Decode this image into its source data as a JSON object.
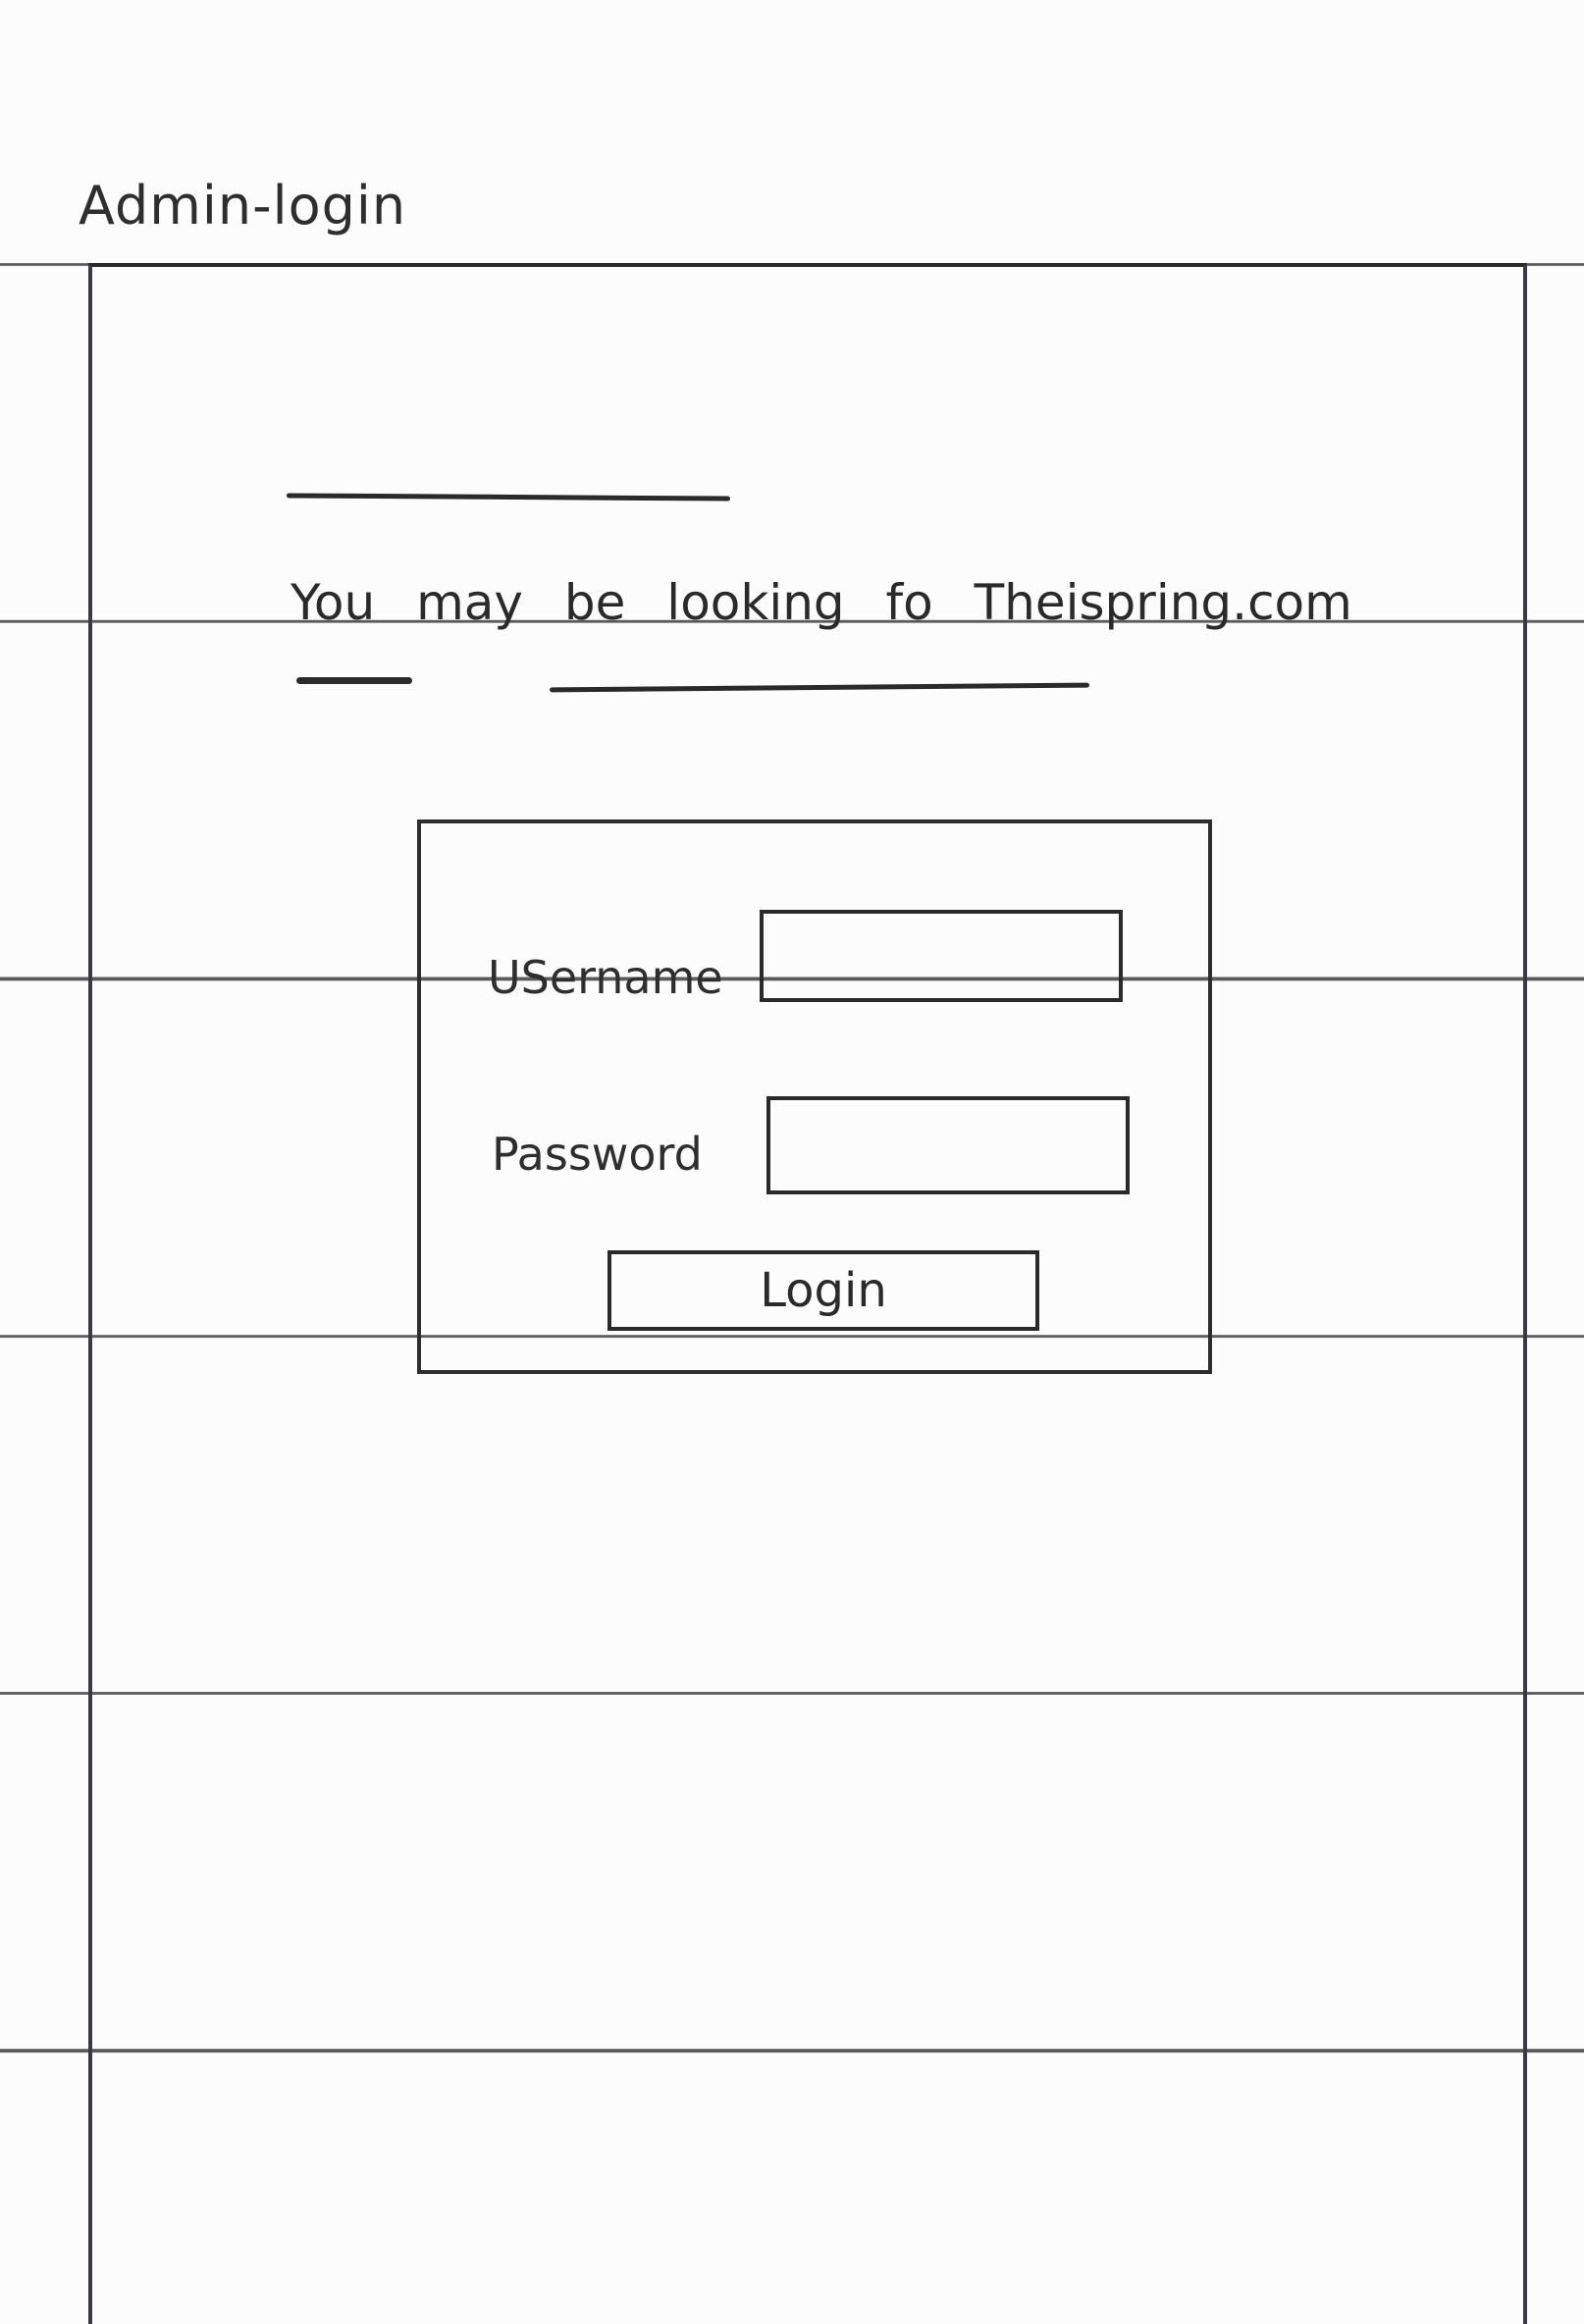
{
  "page": {
    "title": "Admin-login"
  },
  "notice": {
    "text": "You may be looking fo Theispring.com"
  },
  "login_form": {
    "username_label": "USername",
    "password_label": "Password",
    "username_value": "",
    "password_value": "",
    "button_label": "Login"
  }
}
